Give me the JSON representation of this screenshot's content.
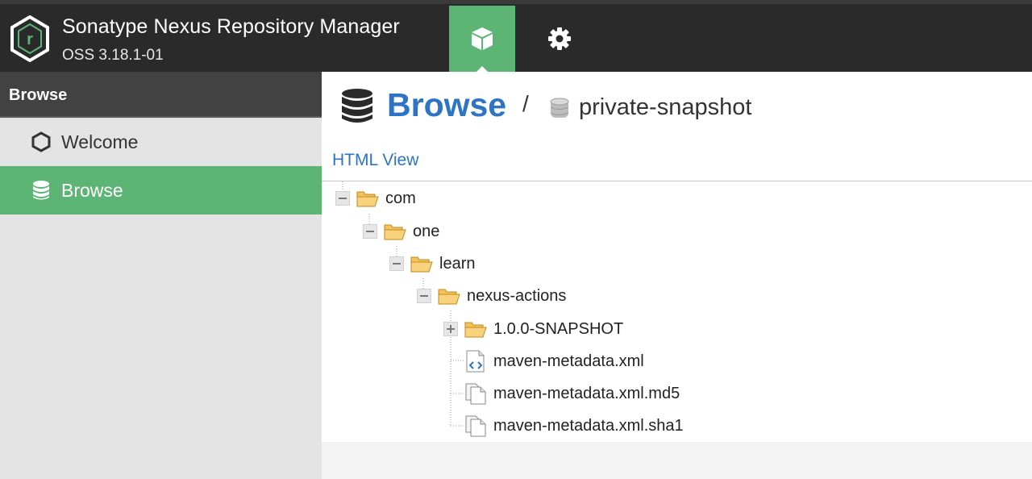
{
  "header": {
    "app_title": "Sonatype Nexus Repository Manager",
    "version": "OSS 3.18.1-01",
    "nav": [
      {
        "name": "browse",
        "icon": "cube-icon",
        "active": true
      },
      {
        "name": "administration",
        "icon": "gear-icon",
        "active": false
      }
    ]
  },
  "colors": {
    "accent_green": "#5cb574",
    "link_blue": "#2d74c4",
    "header_bg": "#2a2a2a",
    "sidebar_header_bg": "#424242"
  },
  "sidebar": {
    "title": "Browse",
    "items": [
      {
        "label": "Welcome",
        "icon": "hexagon-icon",
        "active": false
      },
      {
        "label": "Browse",
        "icon": "database-icon",
        "active": true
      }
    ]
  },
  "main": {
    "breadcrumb": {
      "title": "Browse",
      "separator": "/",
      "repository": "private-snapshot"
    },
    "html_view_link": "HTML View",
    "tree": [
      {
        "label": "com",
        "type": "folder",
        "state": "expanded",
        "depth": 0
      },
      {
        "label": "one",
        "type": "folder",
        "state": "expanded",
        "depth": 1
      },
      {
        "label": "learn",
        "type": "folder",
        "state": "expanded",
        "depth": 2
      },
      {
        "label": "nexus-actions",
        "type": "folder",
        "state": "expanded",
        "depth": 3
      },
      {
        "label": "1.0.0-SNAPSHOT",
        "type": "folder",
        "state": "collapsed",
        "depth": 4
      },
      {
        "label": "maven-metadata.xml",
        "type": "xml-file",
        "state": "leaf",
        "depth": 4
      },
      {
        "label": "maven-metadata.xml.md5",
        "type": "file",
        "state": "leaf",
        "depth": 4
      },
      {
        "label": "maven-metadata.xml.sha1",
        "type": "file",
        "state": "leaf",
        "depth": 4
      }
    ]
  }
}
